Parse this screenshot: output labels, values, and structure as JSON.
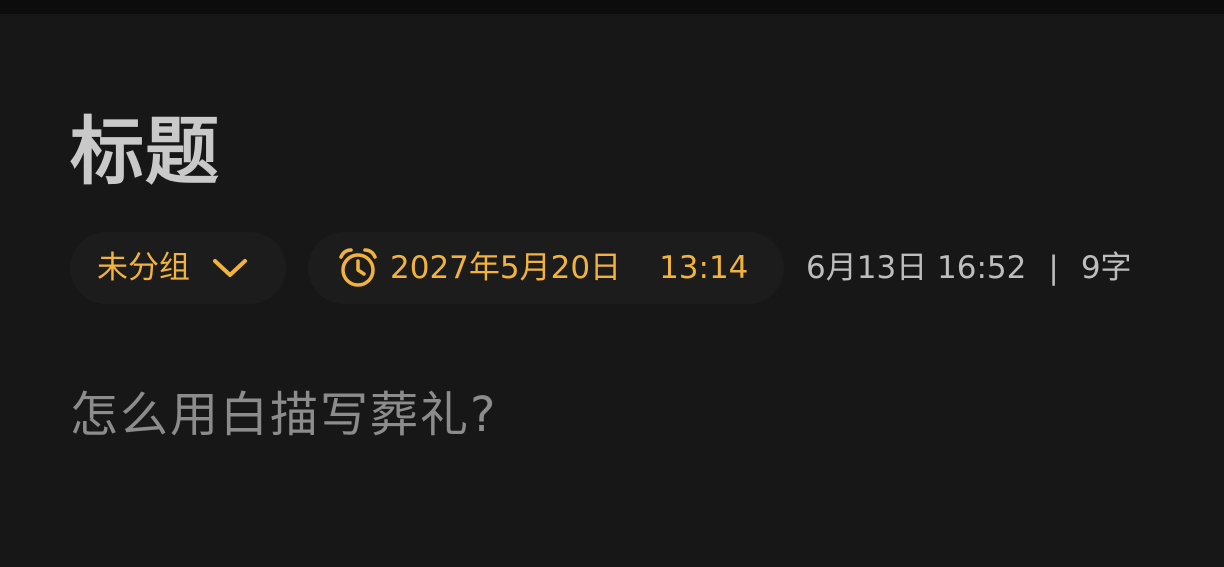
{
  "note": {
    "title": "标题",
    "group_label": "未分组",
    "reminder": {
      "date": "2027年5月20日",
      "time": "13:14"
    },
    "modified": "6月13日 16:52",
    "separator": "|",
    "word_count": "9字",
    "body": "怎么用白描写葬礼?"
  },
  "icons": {
    "group_dropdown": "chevron-down-icon",
    "reminder": "alarm-clock-icon"
  },
  "colors": {
    "background": "#171717",
    "accent": "#f2b33d",
    "title": "#c9c9c9",
    "meta_text": "#bdbdbd",
    "body_text": "#8c8c8c",
    "chip_background": "#1c1c1c"
  }
}
